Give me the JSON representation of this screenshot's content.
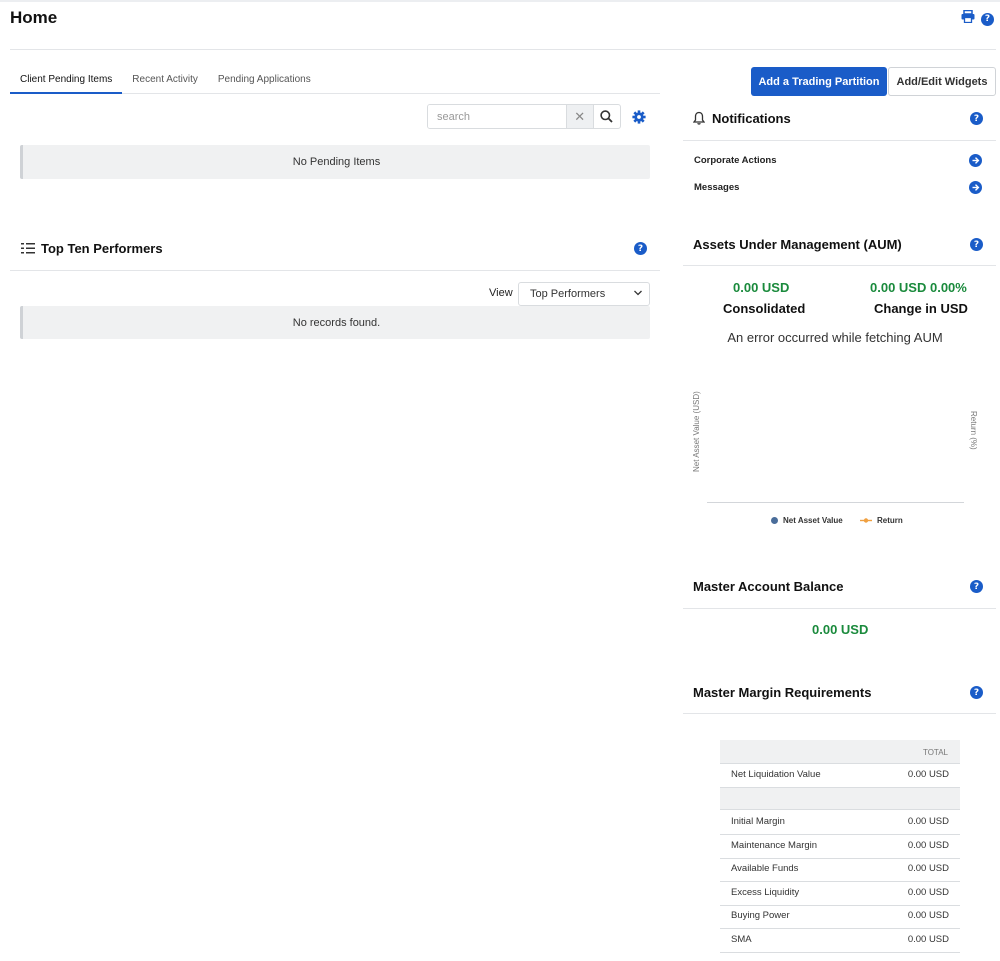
{
  "page": {
    "title": "Home"
  },
  "tabs": [
    {
      "label": "Client Pending Items",
      "active": true
    },
    {
      "label": "Recent Activity",
      "active": false
    },
    {
      "label": "Pending Applications",
      "active": false
    }
  ],
  "search": {
    "placeholder": "search",
    "value": ""
  },
  "pending": {
    "empty_message": "No Pending Items"
  },
  "top_ten": {
    "title": "Top Ten Performers",
    "view_label": "View",
    "view_selected": "Top Performers",
    "empty_message": "No records found."
  },
  "buttons": {
    "add_partition": "Add a Trading Partition",
    "edit_widgets": "Add/Edit Widgets"
  },
  "notifications": {
    "title": "Notifications",
    "items": [
      {
        "label": "Corporate Actions"
      },
      {
        "label": "Messages"
      }
    ]
  },
  "aum": {
    "title": "Assets Under Management (AUM)",
    "consolidated_value": "0.00 USD",
    "consolidated_label": "Consolidated",
    "change_value": "0.00 USD 0.00%",
    "change_label": "Change in USD",
    "error_message": "An error occurred while fetching AUM",
    "left_axis": "Net Asset Value (USD)",
    "right_axis": "Return (%)",
    "legend": [
      {
        "name": "Net Asset Value",
        "color": "#4a6d9a"
      },
      {
        "name": "Return",
        "color": "#f0a040"
      }
    ]
  },
  "master_balance": {
    "title": "Master Account Balance",
    "value": "0.00 USD"
  },
  "margin": {
    "title": "Master Margin Requirements",
    "column_header": "TOTAL",
    "top_row": {
      "label": "Net Liquidation Value",
      "value": "0.00 USD"
    },
    "rows": [
      {
        "label": "Initial Margin",
        "value": "0.00 USD"
      },
      {
        "label": "Maintenance Margin",
        "value": "0.00 USD"
      },
      {
        "label": "Available Funds",
        "value": "0.00 USD"
      },
      {
        "label": "Excess Liquidity",
        "value": "0.00 USD"
      },
      {
        "label": "Buying Power",
        "value": "0.00 USD"
      },
      {
        "label": "SMA",
        "value": "0.00 USD"
      }
    ]
  },
  "colors": {
    "accent": "#1a5cc8",
    "positive": "#1a8a3c"
  },
  "icons": [
    "printer-icon",
    "help-icon",
    "close-icon",
    "search-icon",
    "gear-icon",
    "list-icon",
    "bell-icon",
    "arrow-right-icon",
    "chevron-down-icon"
  ]
}
